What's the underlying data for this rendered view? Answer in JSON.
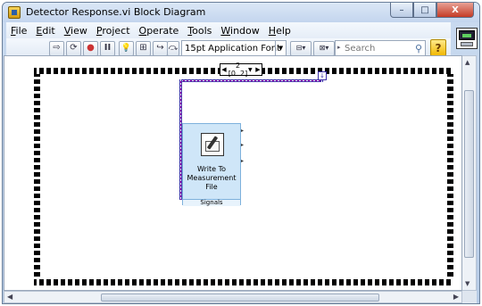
{
  "window": {
    "title": "Detector Response.vi Block Diagram",
    "controls": {
      "minimize": "–",
      "maximize": "□",
      "close": "X"
    }
  },
  "menubar": {
    "items": [
      {
        "label": "File",
        "mnemonic": "F"
      },
      {
        "label": "Edit",
        "mnemonic": "E"
      },
      {
        "label": "View",
        "mnemonic": "V"
      },
      {
        "label": "Project",
        "mnemonic": "P"
      },
      {
        "label": "Operate",
        "mnemonic": "O"
      },
      {
        "label": "Tools",
        "mnemonic": "T"
      },
      {
        "label": "Window",
        "mnemonic": "W"
      },
      {
        "label": "Help",
        "mnemonic": "H"
      }
    ]
  },
  "toolbar": {
    "buttons": [
      {
        "name": "run-arrow-icon",
        "glyph": "⇨"
      },
      {
        "name": "run-continuously-icon",
        "glyph": "⟳"
      },
      {
        "name": "abort-icon",
        "glyph": "●"
      },
      {
        "name": "pause-icon",
        "glyph": "II"
      },
      {
        "name": "highlight-execution-icon",
        "glyph": "💡"
      },
      {
        "name": "retain-wire-values-icon",
        "glyph": "⊞"
      },
      {
        "name": "step-into-icon",
        "glyph": "↪"
      },
      {
        "name": "step-over-icon",
        "glyph": "⤼"
      },
      {
        "name": "step-out-icon",
        "glyph": "↗"
      }
    ],
    "font_selector": "15pt Application Font",
    "align_buttons": [
      {
        "name": "align-objects-icon",
        "glyph": "⊟▾"
      },
      {
        "name": "distribute-objects-icon",
        "glyph": "⊠▾"
      },
      {
        "name": "reorder-icon",
        "glyph": "◈▾"
      },
      {
        "name": "cleanup-diagram-icon",
        "glyph": "⇢"
      }
    ],
    "search": {
      "placeholder": "Search"
    },
    "help_label": "?"
  },
  "diagram": {
    "sequence_frame": {
      "selector_label": "2 [0..2]"
    },
    "express_vi": {
      "name_lines": [
        "Write To",
        "Measurement",
        "File"
      ],
      "terminal": "Signals"
    }
  },
  "scrollbars": {
    "vertical": {
      "position": 0.1
    },
    "horizontal": {
      "position": 0.3
    }
  },
  "colors": {
    "wire_dynamic": "#b30fb3",
    "wire_border": "#3b2fa8",
    "express_vi_fill": "#cfe6f8",
    "titlebar": "#c3d5ee"
  }
}
